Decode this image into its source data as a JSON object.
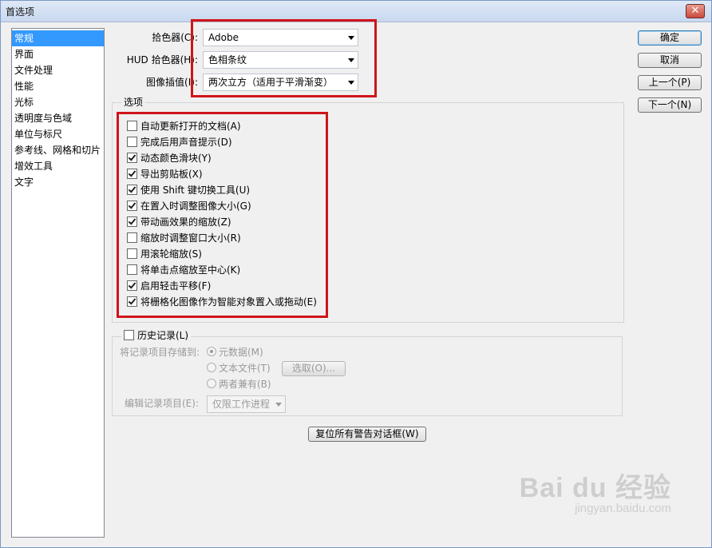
{
  "window": {
    "title": "首选项",
    "close_glyph": "✕"
  },
  "sidebar": {
    "items": [
      {
        "label": "常规",
        "selected": true
      },
      {
        "label": "界面"
      },
      {
        "label": "文件处理"
      },
      {
        "label": "性能"
      },
      {
        "label": "光标"
      },
      {
        "label": "透明度与色域"
      },
      {
        "label": "单位与标尺"
      },
      {
        "label": "参考线、网格和切片"
      },
      {
        "label": "增效工具"
      },
      {
        "label": "文字"
      }
    ]
  },
  "top_settings": {
    "color_picker": {
      "label": "拾色器(C):",
      "value": "Adobe"
    },
    "hud_color_picker": {
      "label": "HUD 拾色器(H):",
      "value": "色相条纹"
    },
    "image_interpolation": {
      "label": "图像插值(I):",
      "value": "两次立方（适用于平滑渐变）"
    }
  },
  "buttons": {
    "ok": "确定",
    "cancel": "取消",
    "prev": "上一个(P)",
    "next": "下一个(N)",
    "reset_warnings": "复位所有警告对话框(W)"
  },
  "options": {
    "title": "选项",
    "items": [
      {
        "label": "自动更新打开的文档(A)",
        "checked": false
      },
      {
        "label": "完成后用声音提示(D)",
        "checked": false
      },
      {
        "label": "动态颜色滑块(Y)",
        "checked": true
      },
      {
        "label": "导出剪贴板(X)",
        "checked": true
      },
      {
        "label": "使用 Shift 键切换工具(U)",
        "checked": true
      },
      {
        "label": "在置入时调整图像大小(G)",
        "checked": true
      },
      {
        "label": "带动画效果的缩放(Z)",
        "checked": true
      },
      {
        "label": "缩放时调整窗口大小(R)",
        "checked": false
      },
      {
        "label": "用滚轮缩放(S)",
        "checked": false
      },
      {
        "label": "将单击点缩放至中心(K)",
        "checked": false
      },
      {
        "label": "启用轻击平移(F)",
        "checked": true
      },
      {
        "label": "将栅格化图像作为智能对象置入或拖动(E)",
        "checked": true
      }
    ]
  },
  "history": {
    "title": "历史记录(L)",
    "checked": false,
    "save_to_label": "将记录项目存储到:",
    "radios": [
      {
        "label": "元数据(M)",
        "checked": true
      },
      {
        "label": "文本文件(T)",
        "checked": false
      },
      {
        "label": "两者兼有(B)",
        "checked": false
      }
    ],
    "choose_button": "选取(O)...",
    "edit_log_label": "编辑记录项目(E):",
    "edit_log_value": "仅限工作进程"
  },
  "watermark": {
    "line1": "Bai du 经验",
    "line2": "jingyan.baidu.com"
  },
  "colors": {
    "selection_blue": "#3399ff",
    "highlight_red": "#d0141a"
  }
}
